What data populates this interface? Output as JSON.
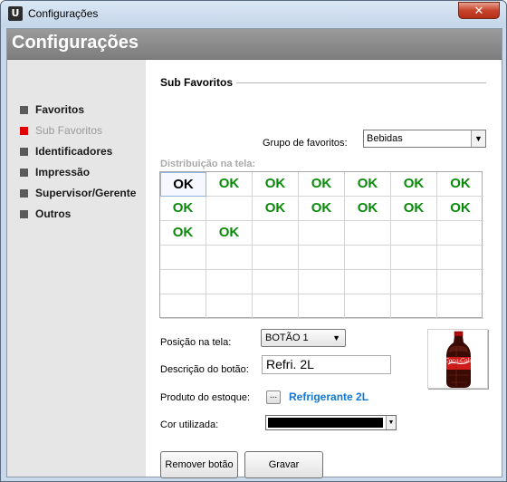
{
  "window": {
    "title": "Configurações",
    "close_glyph": "✕"
  },
  "header": {
    "title": "Configurações"
  },
  "sidebar": {
    "items": [
      {
        "label": "Favoritos",
        "active": false
      },
      {
        "label": "Sub Favoritos",
        "active": true
      },
      {
        "label": "Identificadores",
        "active": false
      },
      {
        "label": "Impressão",
        "active": false
      },
      {
        "label": "Supervisor/Gerente",
        "active": false
      },
      {
        "label": "Outros",
        "active": false
      }
    ]
  },
  "panel": {
    "section_title": "Sub Favoritos",
    "group_label": "Grupo de favoritos:",
    "group_value": "Bebidas",
    "distribution_label": "Distribuição na tela:",
    "grid": {
      "columns": 7,
      "rows": 6,
      "cells": [
        [
          "OK",
          "OK",
          "OK",
          "OK",
          "OK",
          "OK",
          "OK"
        ],
        [
          "OK",
          "",
          "OK",
          "OK",
          "OK",
          "OK",
          "OK"
        ],
        [
          "OK",
          "OK",
          "",
          "",
          "",
          "",
          ""
        ],
        [
          "",
          "",
          "",
          "",
          "",
          "",
          ""
        ],
        [
          "",
          "",
          "",
          "",
          "",
          "",
          ""
        ],
        [
          "",
          "",
          "",
          "",
          "",
          "",
          ""
        ]
      ],
      "selected": [
        0,
        0
      ]
    },
    "position_label": "Posição na tela:",
    "position_value": "BOTÃO 1",
    "description_label": "Descrição do botão:",
    "description_value": "Refri. 2L",
    "stock_label": "Produto do estoque:",
    "stock_button": "...",
    "stock_product": "Refrigerante 2L",
    "color_label": "Cor utilizada:",
    "color_value": "#000000",
    "remove_button": "Remover botão",
    "save_button": "Gravar",
    "product_image_icon": "cola-bottle-icon"
  },
  "colors": {
    "accent_active": "#e00000",
    "ok_green": "#0a8a0a",
    "link_blue": "#1478d2",
    "header_gray": "#8a8a8a"
  }
}
